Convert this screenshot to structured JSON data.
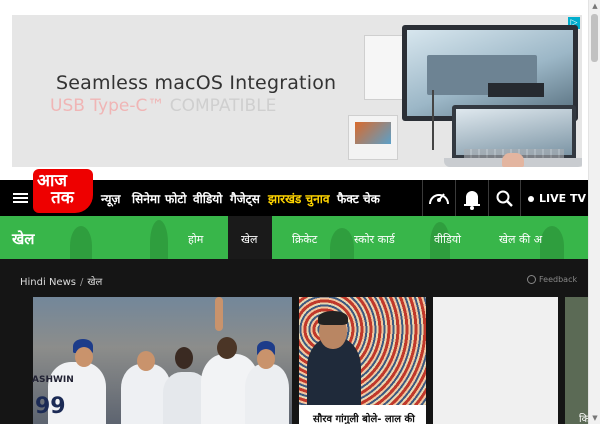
{
  "ad": {
    "line1": "Seamless macOS Integration",
    "line2_colored": "USB Type-C™",
    "line2_rest": " COMPATIBLE",
    "choices_icon": "ad-choices-icon"
  },
  "logo": {
    "line1": "आज",
    "line2": "तक"
  },
  "nav": {
    "items": [
      "न्यूज़",
      "सिनेमा",
      "फोटो",
      "वीडियो",
      "गैजेट्स",
      "झारखंड चुनाव",
      "फैक्ट चेक"
    ],
    "live_label": "LIVE TV",
    "highlight_color": "#ffd400"
  },
  "sports": {
    "title": "खेल",
    "tabs": [
      "होम",
      "खेल",
      "क्रिकेट",
      "स्कोर कार्ड",
      "वीडियो",
      "खेल की अ"
    ],
    "active_tab": "खेल",
    "bar_color": "#38b64a"
  },
  "breadcrumb": {
    "home": "Hindi News",
    "sep": "/",
    "current": "खेल"
  },
  "feedback": "Feedback",
  "cards": {
    "big": {
      "jersey_name": "ASHWIN",
      "jersey_number": "99"
    },
    "small": {
      "caption": "सौरव गांगुली बोले- लाल की"
    },
    "edge": {
      "caption": "कि"
    }
  }
}
